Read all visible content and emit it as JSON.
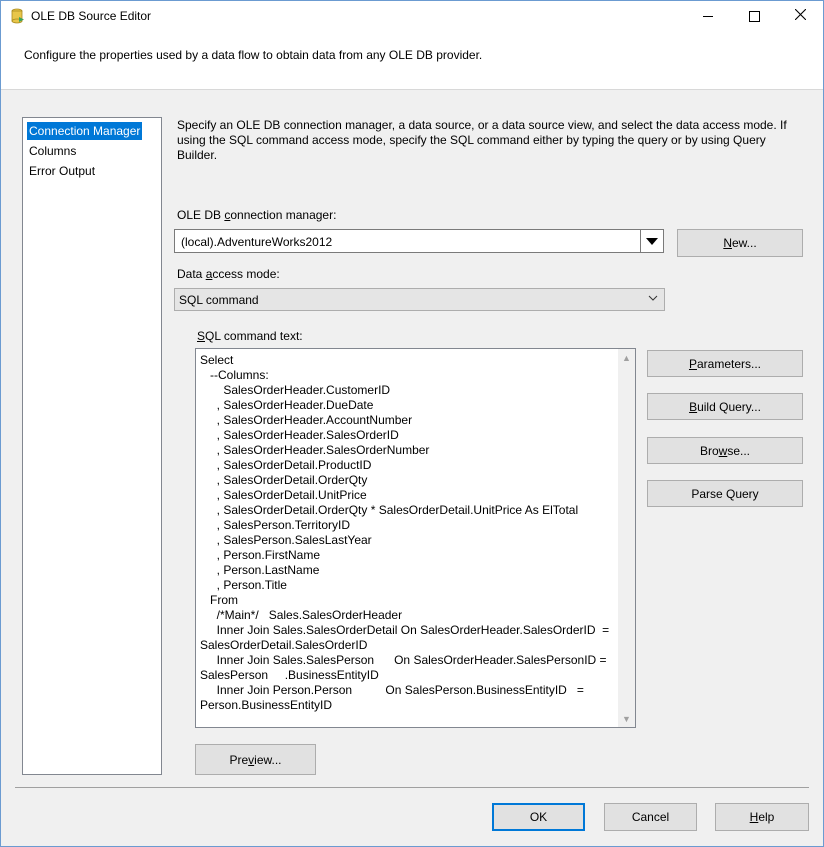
{
  "window": {
    "title": "OLE DB Source Editor",
    "description": "Configure the properties used by a data flow to obtain data from any OLE DB provider."
  },
  "nav": {
    "items": [
      {
        "label": "Connection Manager",
        "selected": true
      },
      {
        "label": "Columns",
        "selected": false
      },
      {
        "label": "Error Output",
        "selected": false
      }
    ]
  },
  "main": {
    "intro": "Specify an OLE DB connection manager, a data source, or a data source view, and select the data access mode. If using the SQL command access mode, specify the SQL command either by typing the query or by using Query Builder.",
    "connection_label_pre": "OLE DB ",
    "connection_label_key": "c",
    "connection_label_post": "onnection manager:",
    "connection_value": "(local).AdventureWorks2012",
    "new_btn_key": "N",
    "new_btn_rest": "ew...",
    "access_label_pre": "Data ",
    "access_label_key": "a",
    "access_label_post": "ccess mode:",
    "access_value": "SQL command",
    "sql_label_key": "S",
    "sql_label_rest": "QL command text:",
    "sql_text": "Select\n   --Columns:\n       SalesOrderHeader.CustomerID\n     , SalesOrderHeader.DueDate\n     , SalesOrderHeader.AccountNumber\n     , SalesOrderHeader.SalesOrderID\n     , SalesOrderHeader.SalesOrderNumber\n     , SalesOrderDetail.ProductID\n     , SalesOrderDetail.OrderQty\n     , SalesOrderDetail.UnitPrice\n     , SalesOrderDetail.OrderQty * SalesOrderDetail.UnitPrice As ElTotal\n     , SalesPerson.TerritoryID\n     , SalesPerson.SalesLastYear\n     , Person.FirstName\n     , Person.LastName\n     , Person.Title\n   From\n     /*Main*/   Sales.SalesOrderHeader\n     Inner Join Sales.SalesOrderDetail On SalesOrderHeader.SalesOrderID  =\nSalesOrderDetail.SalesOrderID\n     Inner Join Sales.SalesPerson      On SalesOrderHeader.SalesPersonID =\nSalesPerson     .BusinessEntityID\n     Inner Join Person.Person          On SalesPerson.BusinessEntityID   =\nPerson.BusinessEntityID",
    "parameters_key": "P",
    "parameters_rest": "arameters...",
    "build_pre": "",
    "build_key": "B",
    "build_rest": "uild Query...",
    "browse_pre": "Bro",
    "browse_key": "w",
    "browse_rest": "se...",
    "parse_label": "Parse Query",
    "preview_pre": "Pre",
    "preview_key": "v",
    "preview_rest": "iew..."
  },
  "footer": {
    "ok": "OK",
    "cancel": "Cancel",
    "help_key": "H",
    "help_rest": "elp"
  },
  "icons": {
    "title_icon": "ssis-source-icon",
    "minimize": "minimize-icon",
    "maximize": "maximize-icon",
    "close": "close-icon"
  },
  "colors": {
    "selection": "#0078d7",
    "window_bg": "#f0f0f0"
  }
}
